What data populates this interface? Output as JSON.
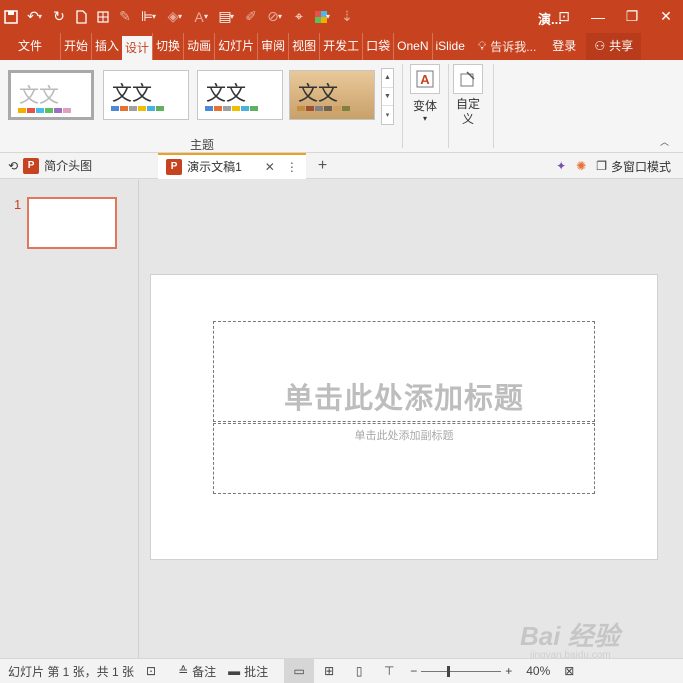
{
  "app": {
    "title": "演...",
    "share_label": "共享",
    "login_label": "登录",
    "tell_me": "告诉我..."
  },
  "tabs": [
    "文件",
    "开始",
    "插入",
    "设计",
    "切换",
    "动画",
    "幻灯片",
    "审阅",
    "视图",
    "开发工",
    "口袋",
    "OneN",
    "iSlide"
  ],
  "active_tab": "设计",
  "ribbon": {
    "themes": [
      {
        "label": "文文",
        "colors": [
          "#f0b000",
          "#e8504a",
          "#4ab8e8",
          "#5cc05c",
          "#a070c0",
          "#e0a0c0"
        ]
      },
      {
        "label": "文文",
        "colors": [
          "#4a8ad8",
          "#e87030",
          "#a0a0a0",
          "#f0c000",
          "#4ab0e0",
          "#60b060"
        ]
      },
      {
        "label": "文文",
        "colors": [
          "#4a8ad8",
          "#e87030",
          "#a0a0a0",
          "#f0c000",
          "#4ab0e0",
          "#60b060"
        ]
      },
      {
        "label": "文文",
        "colors": [
          "#c09040",
          "#a05030",
          "#808080",
          "#706050",
          "#d0a060",
          "#808040"
        ]
      }
    ],
    "group_label": "主题",
    "variants_label": "变体",
    "customize_label": "自定义"
  },
  "doc_tabs": [
    {
      "label": "简介头图"
    },
    {
      "label": "演示文稿1"
    }
  ],
  "doc_right": {
    "multiwindow_label": "多窗口模式"
  },
  "thumbs": {
    "slide_number": "1"
  },
  "slide": {
    "title_placeholder": "单击此处添加标题",
    "subtitle_placeholder": "单击此处添加副标题"
  },
  "watermark": {
    "text": "Bai 经验",
    "sub": "jingyan.baidu.com"
  },
  "status": {
    "slide_info": "幻灯片 第 1 张，共 1 张",
    "notes_label": "备注",
    "comments_label": "批注",
    "zoom": "40%"
  }
}
